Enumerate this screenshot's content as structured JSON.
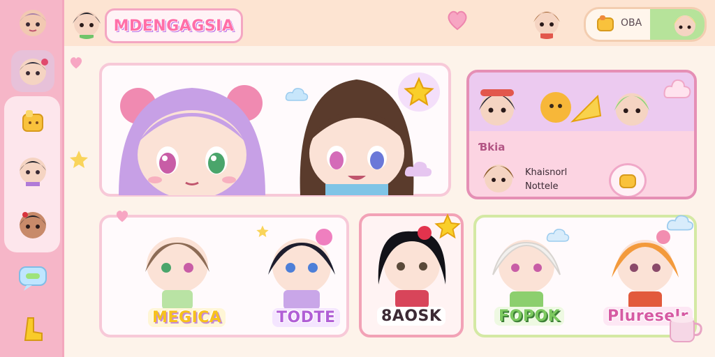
{
  "app": {
    "logo_text": "MDENGAGSIA",
    "status_label": "OBA"
  },
  "colors": {
    "sidebar": "#f6b6c8",
    "topbar": "#fde4d2",
    "accent_pink": "#ff6fa8",
    "accent_purple": "#b96de6",
    "accent_green": "#b6e39a"
  },
  "sidebar": {
    "items": [
      {
        "icon": "avatar-icon"
      },
      {
        "icon": "chat-bubble-icon"
      },
      {
        "icon": "bread-icon"
      },
      {
        "icon": "avatar-icon"
      },
      {
        "icon": "avatar-icon"
      },
      {
        "icon": "speech-bubble-icon"
      },
      {
        "icon": "boot-icon"
      }
    ]
  },
  "event": {
    "tag": "Ɓkia",
    "lines": [
      "Khaisnorl",
      "Nottele"
    ]
  },
  "characters": [
    {
      "name": "MEGICA",
      "style": "yellow"
    },
    {
      "name": "TODTE",
      "style": "purple"
    },
    {
      "name": "8AOSK",
      "style": "dark"
    },
    {
      "name": "FOPOK",
      "style": "green"
    },
    {
      "name": "Plureselr",
      "style": "pink"
    }
  ]
}
